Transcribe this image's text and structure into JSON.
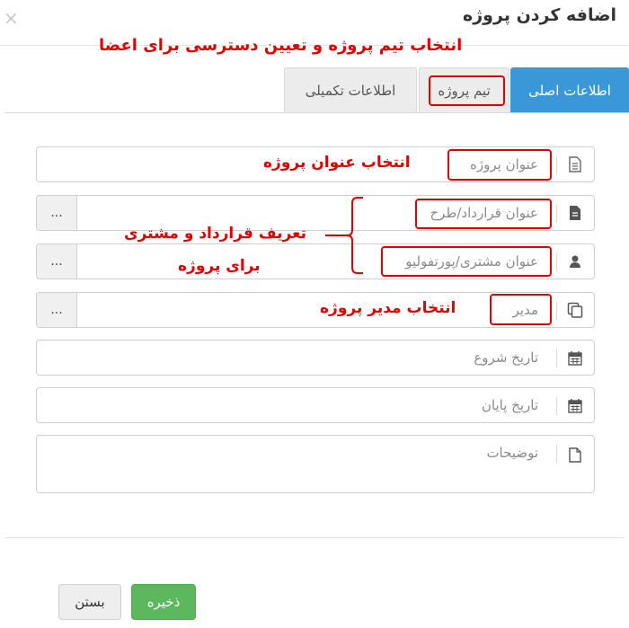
{
  "dialog": {
    "title": "اضافه کردن پروژه",
    "close_glyph": "×"
  },
  "tabs": [
    {
      "label": "اطلاعات اصلی",
      "active": true
    },
    {
      "label": "تیم پروژه",
      "active": false
    },
    {
      "label": "اطلاعات تکمیلی",
      "active": false
    }
  ],
  "fields": {
    "project_title": {
      "placeholder": "عنوان پروژه",
      "icon": "document-lines-icon"
    },
    "contract_title": {
      "placeholder": "عنوان قرارداد/طرح",
      "icon": "document-filled-icon",
      "lookup": "..."
    },
    "customer_title": {
      "placeholder": "عنوان مشتری/پورتفولیو",
      "icon": "user-icon",
      "lookup": "..."
    },
    "manager": {
      "placeholder": "مدیر",
      "icon": "copy-icon",
      "lookup": "..."
    },
    "start_date": {
      "placeholder": "تاریخ شروع",
      "icon": "calendar-icon"
    },
    "end_date": {
      "placeholder": "تاریخ پایان",
      "icon": "calendar-icon"
    },
    "description": {
      "placeholder": "توضیحات",
      "icon": "file-outline-icon"
    }
  },
  "annotations": {
    "team_note": "انتخاب تیم پروژه و تعیین دسترسی برای اعضا",
    "title_note": "انتخاب عنوان پروژه",
    "contract_note_line1": "تعریف قرارداد و مشتری",
    "contract_note_line2": "برای پروژه",
    "manager_note": "انتخاب مدیر پروژه"
  },
  "footer": {
    "save_label": "ذخیره",
    "close_label": "بستن"
  },
  "colors": {
    "active_tab": "#3a98d8",
    "annotation": "#e00000",
    "save_button": "#5cb85c"
  }
}
